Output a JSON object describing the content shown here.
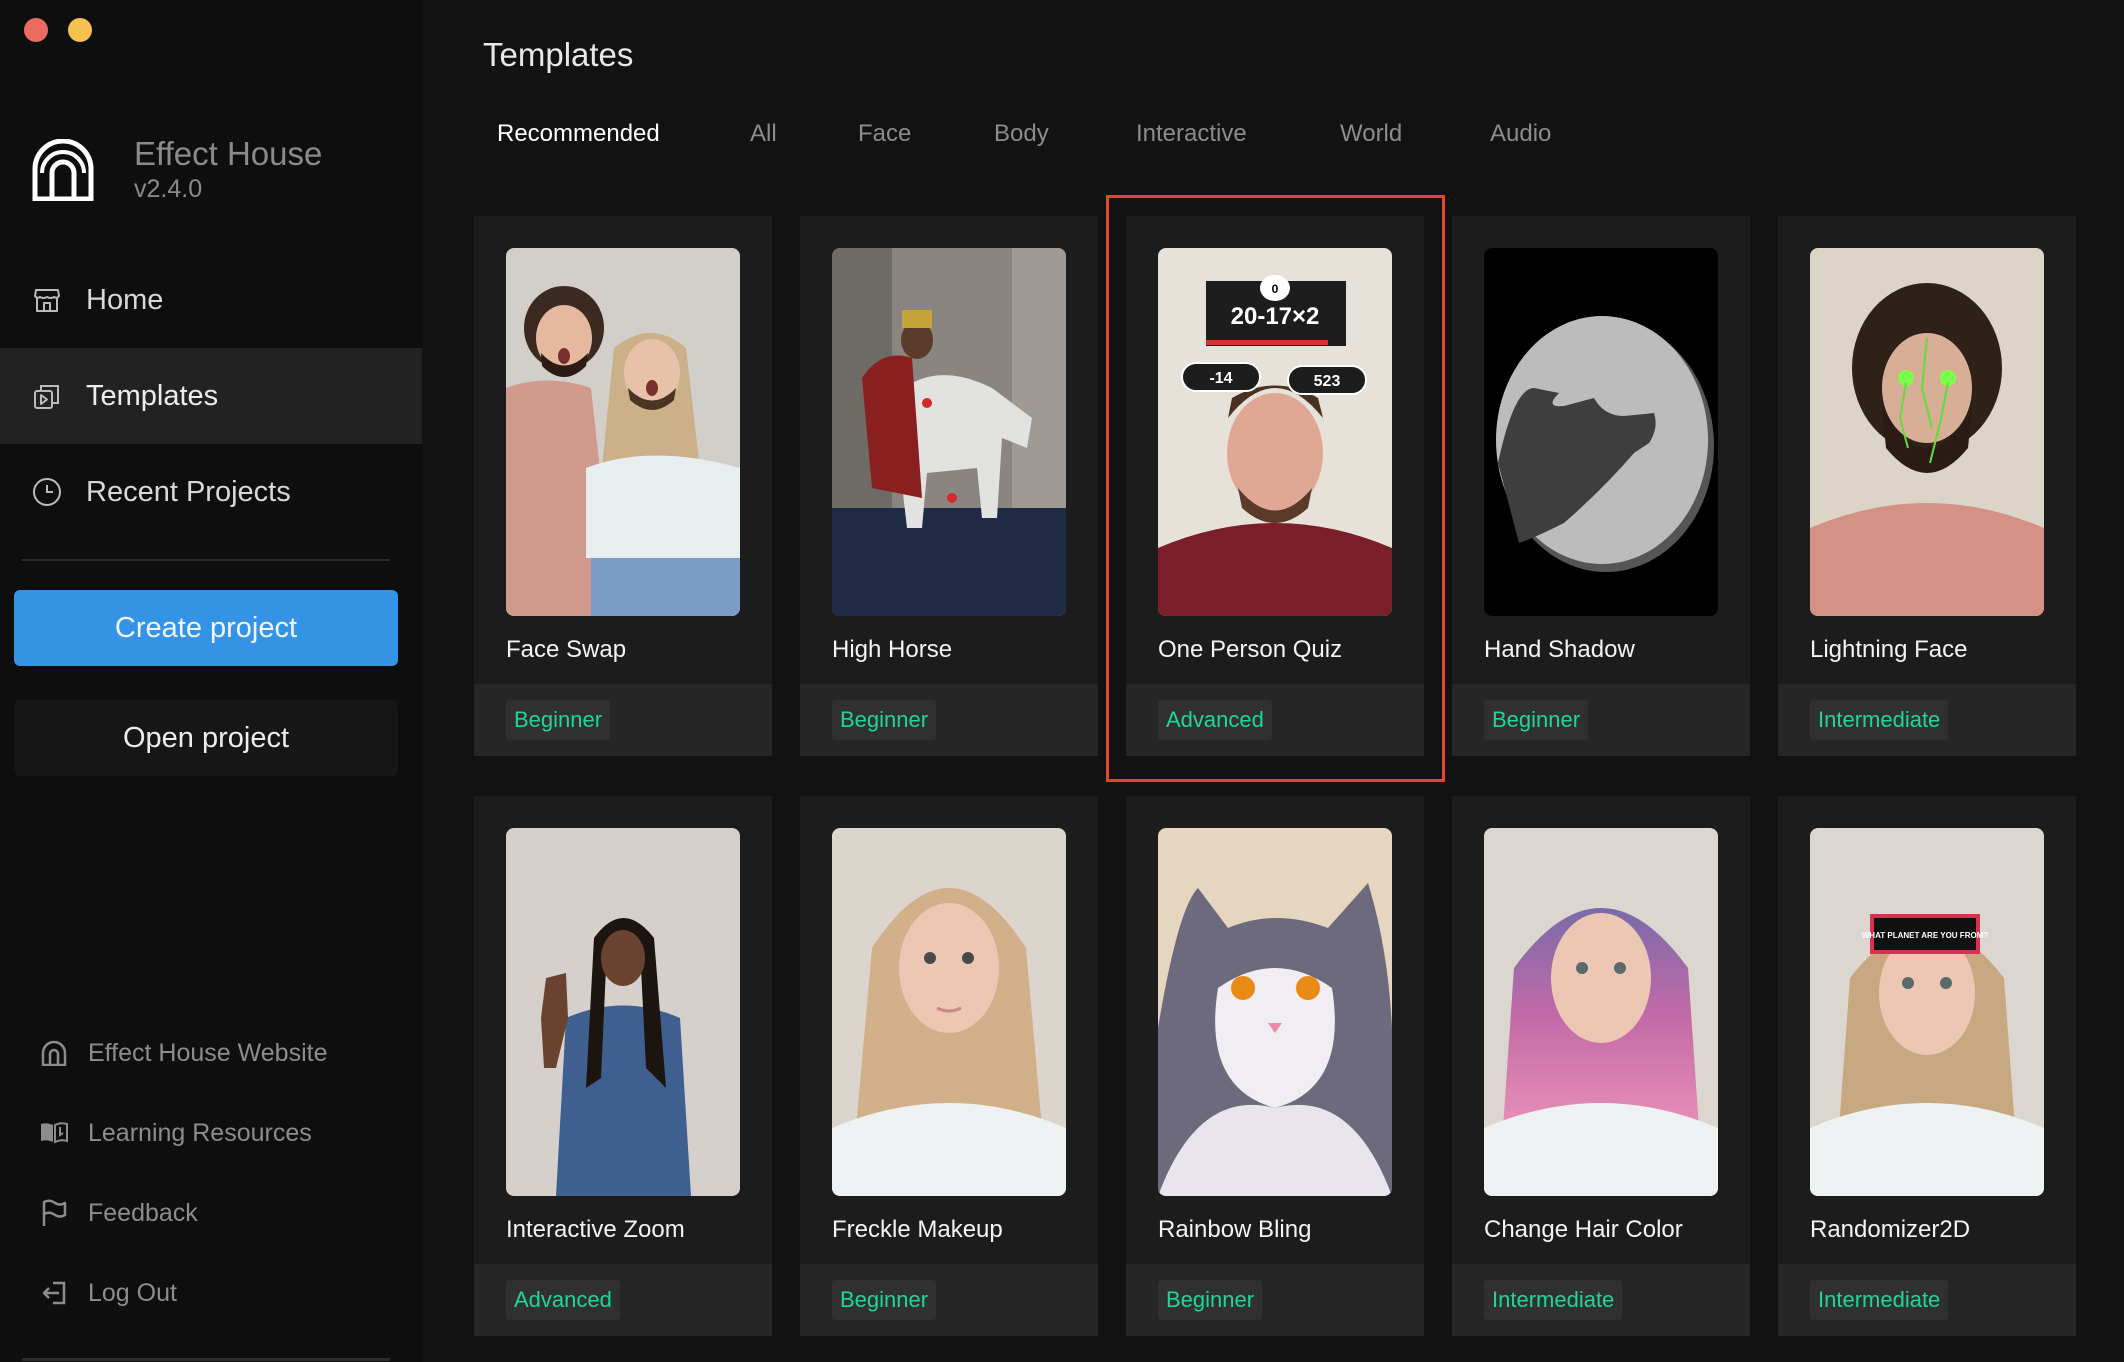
{
  "window": {
    "controls": [
      "close",
      "minimize"
    ],
    "colors": {
      "close": "#ec6b60",
      "minimize": "#f5c150"
    }
  },
  "brand": {
    "name": "Effect House",
    "version": "v2.4.0",
    "logo_icon": "effect-house-arch-icon"
  },
  "sidebar": {
    "nav": [
      {
        "label": "Home",
        "icon": "home-store-icon",
        "active": false
      },
      {
        "label": "Templates",
        "icon": "templates-icon",
        "active": true
      },
      {
        "label": "Recent Projects",
        "icon": "clock-icon",
        "active": false
      }
    ],
    "create_button": "Create project",
    "open_button": "Open project",
    "links": [
      {
        "label": "Effect House Website",
        "icon": "effect-house-icon"
      },
      {
        "label": "Learning Resources",
        "icon": "book-icon"
      },
      {
        "label": "Feedback",
        "icon": "flag-icon"
      },
      {
        "label": "Log Out",
        "icon": "logout-icon"
      }
    ]
  },
  "main": {
    "title": "Templates",
    "tabs": [
      {
        "label": "Recommended",
        "active": true
      },
      {
        "label": "All",
        "active": false
      },
      {
        "label": "Face",
        "active": false
      },
      {
        "label": "Body",
        "active": false
      },
      {
        "label": "Interactive",
        "active": false
      },
      {
        "label": "World",
        "active": false
      },
      {
        "label": "Audio",
        "active": false
      }
    ],
    "templates": [
      {
        "title": "Face Swap",
        "level": "Beginner"
      },
      {
        "title": "High Horse",
        "level": "Beginner"
      },
      {
        "title": "One Person Quiz",
        "level": "Advanced",
        "highlighted": true,
        "overlay": {
          "score": "0",
          "question": "20-17×2",
          "answers": [
            "-14",
            "523"
          ]
        }
      },
      {
        "title": "Hand Shadow",
        "level": "Beginner"
      },
      {
        "title": "Lightning Face",
        "level": "Intermediate"
      },
      {
        "title": "Interactive Zoom",
        "level": "Advanced"
      },
      {
        "title": "Freckle Makeup",
        "level": "Beginner"
      },
      {
        "title": "Rainbow Bling",
        "level": "Beginner"
      },
      {
        "title": "Change Hair Color",
        "level": "Intermediate"
      },
      {
        "title": "Randomizer2D",
        "level": "Intermediate",
        "overlay": {
          "sign": "WHAT PLANET ARE YOU FROM?"
        }
      }
    ],
    "colors": {
      "accent": "#3593e6",
      "level_text": "#1ed69a",
      "highlight_border": "#e8442a"
    }
  }
}
